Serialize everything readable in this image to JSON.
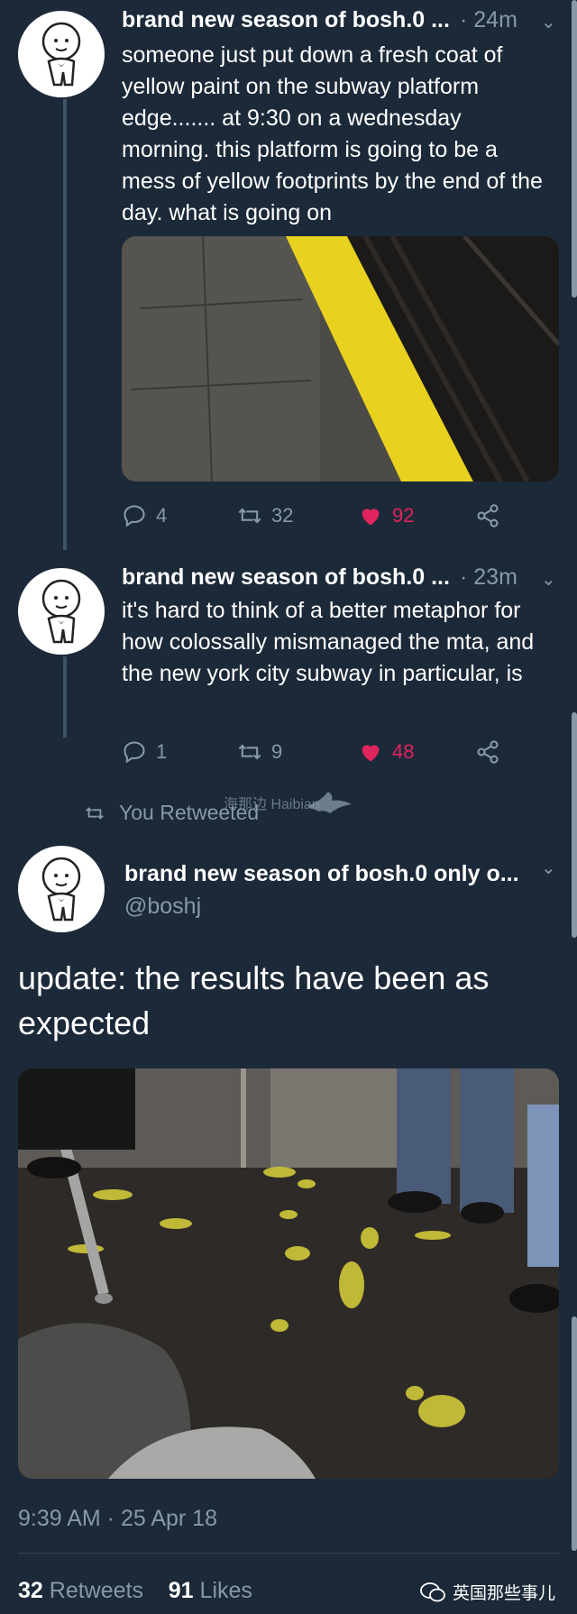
{
  "tweets": [
    {
      "name": "brand new season of bosh.0 ...",
      "time": "· 24m",
      "text": "someone just put down a fresh coat of yellow paint on the subway platform edge....... at 9:30 on a wednesday morning. this platform is going to be a mess of yellow footprints by the end of the day. what is going on",
      "replies": "4",
      "retweets": "32",
      "likes": "92"
    },
    {
      "name": "brand new season of bosh.0 ...",
      "time": "· 23m",
      "text": "it's hard to think of a better metaphor for how colossally mismanaged the mta, and the new york city subway in particular, is",
      "replies": "1",
      "retweets": "9",
      "likes": "48"
    }
  ],
  "retweet_context": "You Retweeted",
  "watermark": "海那边 Haibian",
  "main_tweet": {
    "name": "brand new season of bosh.0 only o...",
    "handle": "@boshj",
    "text": "update: the results have been as expected",
    "timestamp": "9:39 AM · 25 Apr 18",
    "retweet_count": "32",
    "retweet_label": "Retweets",
    "like_count": "91",
    "like_label": "Likes"
  },
  "footer_watermark": "英国那些事儿",
  "colors": {
    "background": "#1c2938",
    "secondary_text": "#8899a6",
    "like": "#e0245e",
    "thread_line": "#3d5466"
  }
}
